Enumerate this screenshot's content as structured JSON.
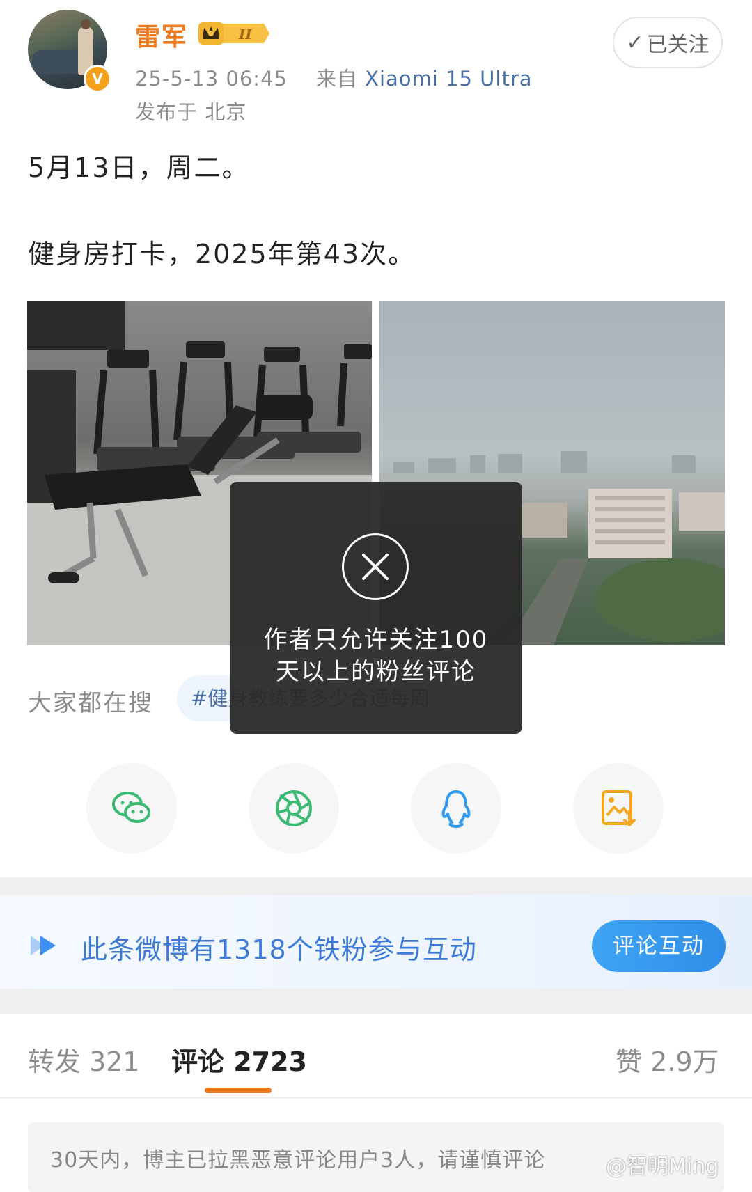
{
  "user": {
    "name": "雷军",
    "verified_badge": "V",
    "post_time": "25-5-13 06:45",
    "source_prefix": "来自",
    "device": "Xiaomi 15 Ultra",
    "location": "发布于 北京"
  },
  "follow": {
    "label": "已关注",
    "icon": "check-icon"
  },
  "post": {
    "line1": "5月13日，周二。",
    "line2": "健身房打卡，2025年第43次。"
  },
  "search": {
    "label": "大家都在搜",
    "topic": "#健身教练要多少合适每周"
  },
  "toast": {
    "message_line1": "作者只允许关注100",
    "message_line2": "天以上的粉丝评论"
  },
  "share_icons": [
    "wechat-icon",
    "moments-icon",
    "qq-icon",
    "save-image-icon"
  ],
  "banner": {
    "text": "此条微博有1318个铁粉参与互动",
    "button": "评论互动"
  },
  "tabs": {
    "repost": "转发 321",
    "comment": "评论 2723",
    "like": "赞 2.9万"
  },
  "notice": "30天内，博主已拉黑恶意评论用户3人，请谨慎评论",
  "watermark": "@智明Ming",
  "colors": {
    "username": "#f07a1a",
    "link": "#4a6fa5",
    "banner_text": "#3d7bd6",
    "tab_indicator": "#f07a1a"
  }
}
